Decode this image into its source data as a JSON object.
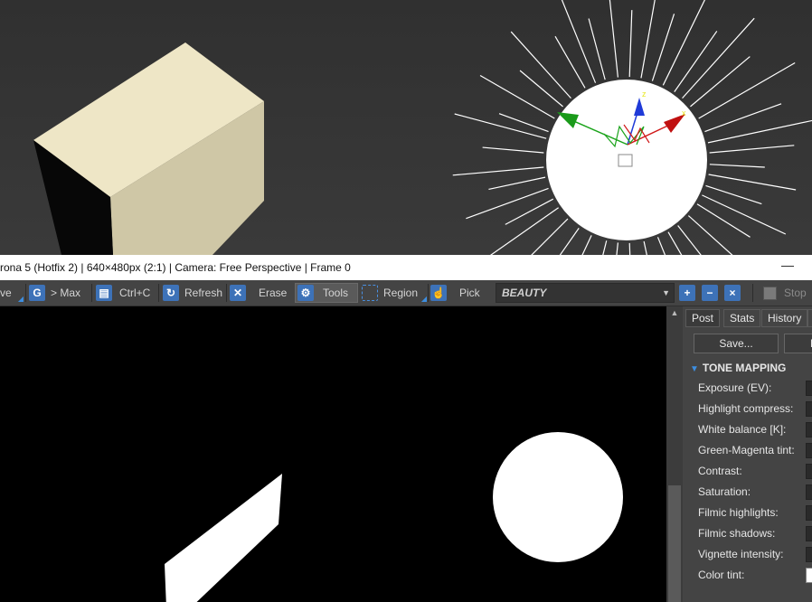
{
  "viewport": {
    "gizmo_axes": [
      "z",
      "x"
    ]
  },
  "vfb": {
    "title": "rona 5 (Hotfix 2) | 640×480px (2:1) | Camera: Free Perspective | Frame 0",
    "minimize": "—",
    "toolbar": {
      "save_partial": "ve",
      "to_max": "> Max",
      "copy": "Ctrl+C",
      "refresh": "Refresh",
      "erase": "Erase",
      "tools": "Tools",
      "region": "Region",
      "pick": "Pick",
      "channel": "BEAUTY",
      "stop": "Stop"
    },
    "panel": {
      "tabs": [
        "Post",
        "Stats",
        "History"
      ],
      "active_tab": "Post",
      "save_button": "Save...",
      "load_button_partial": "L",
      "section": "TONE MAPPING",
      "params": [
        "Exposure (EV):",
        "Highlight compress:",
        "White balance [K]:",
        "Green-Magenta tint:",
        "Contrast:",
        "Saturation:",
        "Filmic highlights:",
        "Filmic shadows:",
        "Vignette intensity:",
        "Color tint:"
      ]
    }
  },
  "colors": {
    "viewport_bg": "#333333",
    "box_top": "#eee6c6",
    "box_side": "#c9c1a0",
    "accent_blue": "#3d72b8",
    "render_bg": "#000000"
  }
}
